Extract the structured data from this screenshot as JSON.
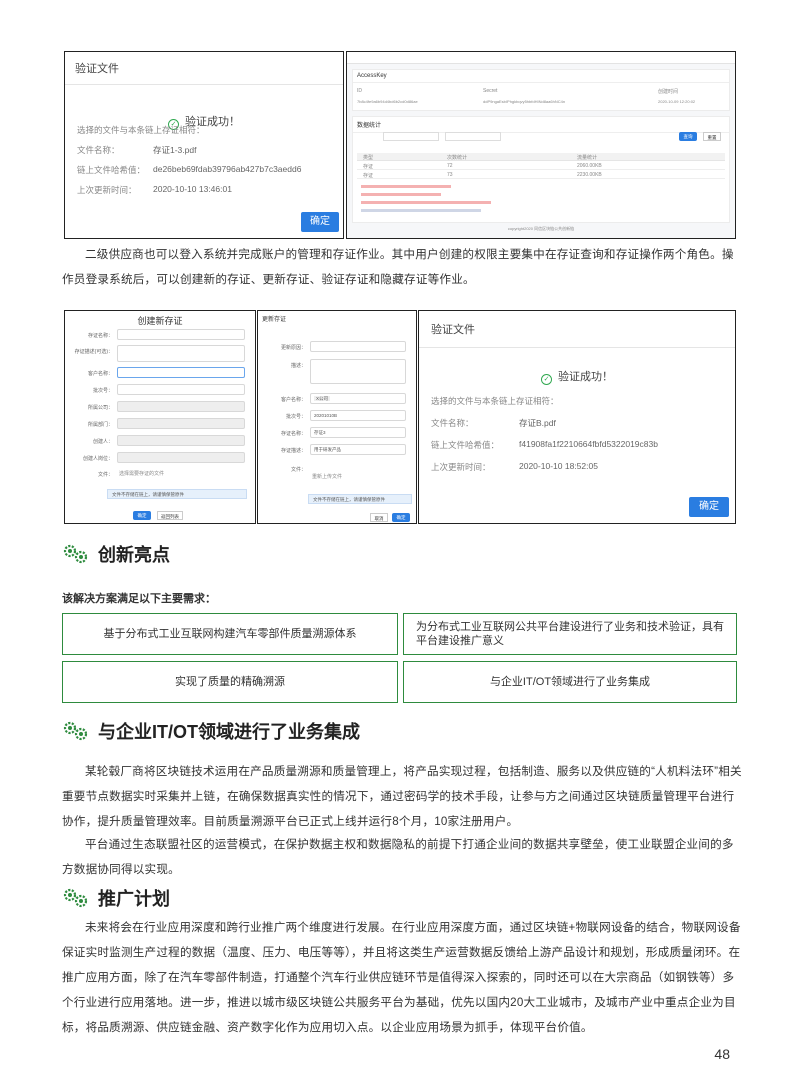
{
  "shot1": {
    "title": "验证文件",
    "success": "验证成功！",
    "match_text": "选择的文件与本条链上存证相符：",
    "rows": [
      {
        "label": "文件名称：",
        "value": "存证1-3.pdf"
      },
      {
        "label": "链上文件哈希值：",
        "value": "de26beb69fdab39796ab427b7c3aedd6"
      },
      {
        "label": "上次更新时间：",
        "value": "2020-10-10 13:46:01"
      }
    ],
    "confirm": "确定"
  },
  "shot2": {
    "section1": "AccessKey",
    "col1": "ID",
    "col2": "Secret",
    "col3": "创建时间",
    "row_id": "7b8c4fe9a6b94d4bd6b2cd0d86ae",
    "row_secret": "ddP9ngaEsbIPhgkbqvy5hbfdHINd8aa6hNC4n",
    "row_time": "2020-10-09 12:20:02",
    "section2": "数据统计",
    "query_btn": "查询",
    "reset_btn": "重置",
    "stat_headers": [
      "类型",
      "次数统计",
      "流量统计"
    ],
    "stat_rows": [
      [
        "存证",
        "72",
        "2060.00KB"
      ],
      [
        "存证",
        "73",
        "2230.00KB"
      ]
    ],
    "footer": "copyright2020 同信区块链公共创新链"
  },
  "shot3": {
    "title": "创建新存证",
    "labels": [
      "存证名称：",
      "存证描述(可选)：",
      "客户名称：",
      "批次号：",
      "所属公司：",
      "所属部门：",
      "创建人：",
      "创建人岗位：",
      "文件："
    ],
    "upload": "选择需要存证的文件",
    "notice": "文件不存储在链上，请谨慎保管原件",
    "ok": "确定",
    "cancel": "返回列表"
  },
  "shot4": {
    "title": "更新存证",
    "labels": [
      "更新原因：",
      "描述：",
      "客户名称：",
      "批次号：",
      "存证名称：",
      "存证描述：",
      "文件："
    ],
    "batch": "20201010B",
    "name": "存证3",
    "desc": "用于研发产品",
    "tag": "X公司",
    "upload": "重新上传文件",
    "notice": "文件不存储在链上，请谨慎保管原件",
    "cancel": "取消",
    "ok": "确定"
  },
  "shot5": {
    "title": "验证文件",
    "success": "验证成功！",
    "match_text": "选择的文件与本条链上存证相符：",
    "rows": [
      {
        "label": "文件名称：",
        "value": "存证B.pdf"
      },
      {
        "label": "链上文件哈希值：",
        "value": "f41908fa1f2210664fbfd5322019c83b"
      },
      {
        "label": "上次更新时间：",
        "value": "2020-10-10 18:52:05"
      }
    ],
    "confirm": "确定"
  },
  "para1": "二级供应商也可以登入系统并完成账户的管理和存证作业。其中用户创建的权限主要集中在存证查询和存证操作两个角色。操作员登录系统后，可以创建新的存证、更新存证、验证存证和隐藏存证等作业。",
  "sec1": "创新亮点",
  "intro": "该解决方案满足以下主要需求：",
  "boxes": [
    "基于分布式工业互联网构建汽车零部件质量溯源体系",
    "为分布式工业互联网公共平台建设进行了业务和技术验证，具有平台建设推广意义",
    "实现了质量的精确溯源",
    "与企业IT/OT领域进行了业务集成"
  ],
  "sec2": "与企业IT/OT领域进行了业务集成",
  "para2": "某轮毂厂商将区块链技术运用在产品质量溯源和质量管理上，将产品实现过程，包括制造、服务以及供应链的“人机料法环”相关重要节点数据实时采集并上链，在确保数据真实性的情况下，通过密码学的技术手段，让参与方之间通过区块链质量管理平台进行协作，提升质量管理效率。目前质量溯源平台已正式上线并运行8个月，10家注册用户。",
  "para3": "平台通过生态联盟社区的运营模式，在保护数据主权和数据隐私的前提下打通企业间的数据共享壁垒，使工业联盟企业间的多方数据协同得以实现。",
  "sec3": "推广计划",
  "para4": "未来将会在行业应用深度和跨行业推广两个维度进行发展。在行业应用深度方面，通过区块链+物联网设备的结合，物联网设备保证实时监测生产过程的数据（温度、压力、电压等等），并且将这类生产运营数据反馈给上游产品设计和规划，形成质量闭环。在推广应用方面，除了在汽车零部件制造，打通整个汽车行业供应链环节是值得深入探索的，同时还可以在大宗商品（如钢铁等）多个行业进行应用落地。进一步，推进以城市级区块链公共服务平台为基础，优先以国内20大工业城市，及城市产业中重点企业为目标，将品质溯源、供应链金融、资产数字化作为应用切入点。以企业应用场景为抓手，体现平台价值。",
  "page_number": "48",
  "colors": {
    "accent": "#2e8b3e",
    "button": "#2a7de1"
  }
}
